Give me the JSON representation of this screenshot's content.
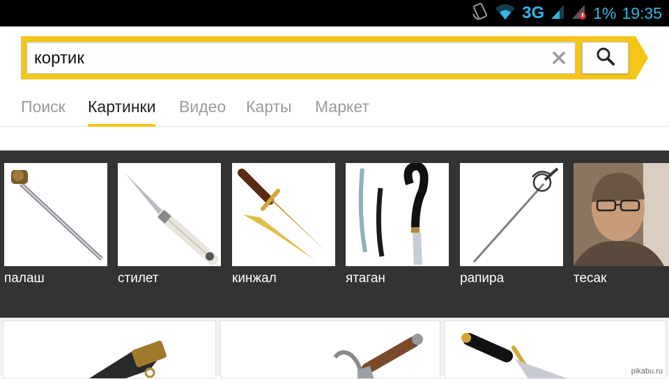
{
  "status_bar": {
    "network": "3G",
    "battery": "1%",
    "time": "19:35",
    "accent_color": "#33b5e5"
  },
  "search": {
    "query": "кортик",
    "accent_color": "#f5c518"
  },
  "tabs": [
    {
      "label": "Поиск",
      "active": false
    },
    {
      "label": "Картинки",
      "active": true
    },
    {
      "label": "Видео",
      "active": false
    },
    {
      "label": "Карты",
      "active": false
    },
    {
      "label": "Маркет",
      "active": false
    }
  ],
  "related": [
    {
      "label": "палаш",
      "icon": "broadsword"
    },
    {
      "label": "стилет",
      "icon": "stiletto-knife"
    },
    {
      "label": "кинжал",
      "icon": "dagger"
    },
    {
      "label": "ятаган",
      "icon": "yatagan"
    },
    {
      "label": "рапира",
      "icon": "rapier"
    },
    {
      "label": "тесак",
      "icon": "person-photo"
    }
  ],
  "results": [
    {
      "icon": "dirk-sheath"
    },
    {
      "icon": "ornate-dagger"
    },
    {
      "icon": "gold-dirk"
    }
  ],
  "watermark": "pikabu.ru"
}
